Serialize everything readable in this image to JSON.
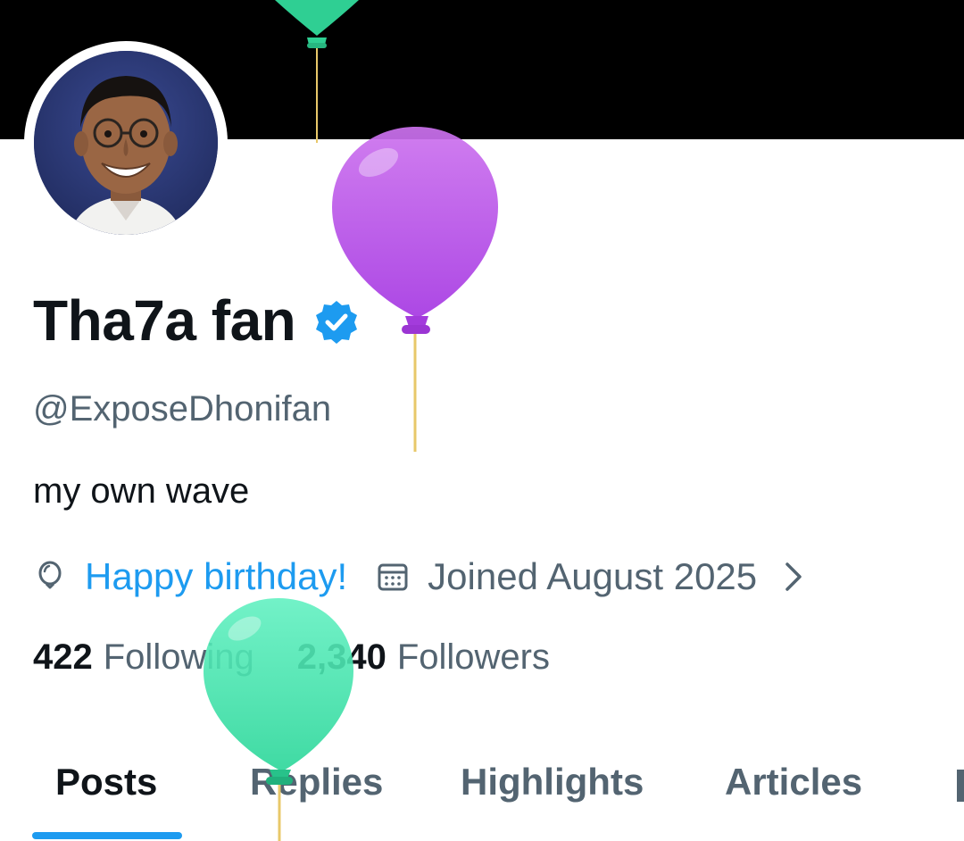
{
  "profile": {
    "display_name": "Tha7a fan",
    "handle": "@ExposeDhonifan",
    "bio": "my own wave",
    "birthday_text": "Happy birthday!",
    "joined_text": "Joined August 2025",
    "following_count": "422",
    "following_label": "Following",
    "followers_count": "2,340",
    "followers_label": "Followers"
  },
  "tabs": [
    {
      "label": "Posts",
      "active": true
    },
    {
      "label": "Replies",
      "active": false
    },
    {
      "label": "Highlights",
      "active": false
    },
    {
      "label": "Articles",
      "active": false
    }
  ],
  "icons": {
    "verified": "verified-badge-icon",
    "birthday": "balloon-icon",
    "joined": "calendar-icon",
    "chevron": "chevron-right-icon"
  },
  "colors": {
    "accent": "#1d9bf0",
    "text_primary": "#0f1419",
    "text_secondary": "#536471",
    "banner": "#000000",
    "balloon_purple": "#b44ee6",
    "balloon_green": "#3ee0a8"
  }
}
